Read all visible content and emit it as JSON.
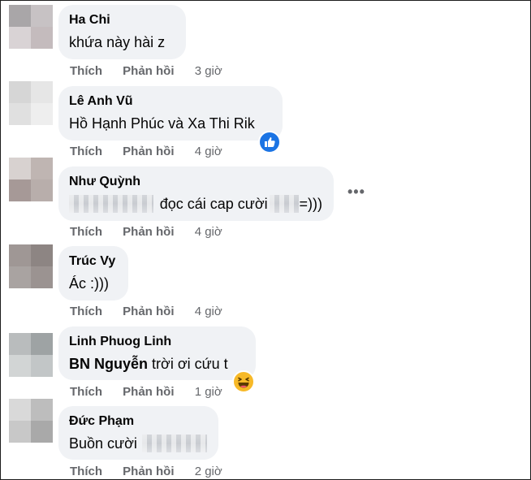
{
  "comments": [
    {
      "author": "Ha Chi",
      "text": "khứa này hài z",
      "like_label": "Thích",
      "reply_label": "Phản hồi",
      "time": "3 giờ",
      "avatar_colors": [
        "#a9a6a8",
        "#c7c2c4",
        "#d9d3d5",
        "#c4bbbd"
      ]
    },
    {
      "author": "Lê Anh Vũ",
      "text": "Hồ Hạnh Phúc và Xa Thi Rik",
      "like_label": "Thích",
      "reply_label": "Phản hồi",
      "time": "4 giờ",
      "reaction": "like-icon",
      "avatar_colors": [
        "#d6d6d6",
        "#e6e6e6",
        "#e0e0e0",
        "#eeeeee"
      ]
    },
    {
      "author": "Như Quỳnh",
      "text_after": "đọc cái cap cười",
      "text_end": "=)))",
      "like_label": "Thích",
      "reply_label": "Phản hồi",
      "time": "4 giờ",
      "more_label": "•••",
      "avatar_colors": [
        "#d8d2d0",
        "#bfb5b2",
        "#a69997",
        "#b8aeab"
      ]
    },
    {
      "author": "Trúc Vy",
      "text": "Ác :)))",
      "like_label": "Thích",
      "reply_label": "Phản hồi",
      "time": "4 giờ",
      "avatar_colors": [
        "#9f9795",
        "#8d8583",
        "#a9a3a1",
        "#9b9391"
      ]
    },
    {
      "author": "Linh Phuog Linh",
      "mention": "BN Nguyễn",
      "text": "trời ơi cứu t",
      "like_label": "Thích",
      "reply_label": "Phản hồi",
      "time": "1 giờ",
      "reaction": "haha-icon",
      "avatar_colors": [
        "#b9bcbd",
        "#9ea3a4",
        "#d2d5d5",
        "#c2c6c7"
      ]
    },
    {
      "author": "Đức Phạm",
      "text": "Buồn cười",
      "like_label": "Thích",
      "reply_label": "Phản hồi",
      "time": "2 giờ",
      "avatar_colors": [
        "#d9d9d9",
        "#bdbdbd",
        "#c8c8c8",
        "#a9a9a9"
      ]
    }
  ],
  "colors": {
    "bubble": "#f0f2f5",
    "action_text": "#65676b",
    "like_blue": "#1b74e4",
    "haha_yellow": "#f7b928"
  }
}
